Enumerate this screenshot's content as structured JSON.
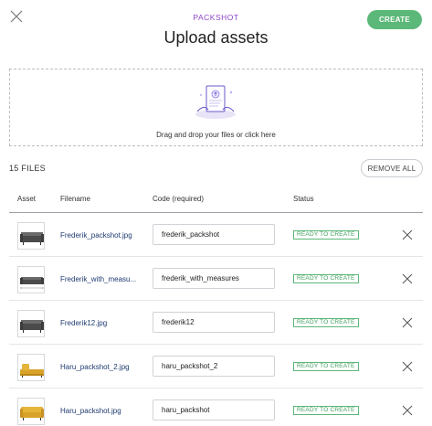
{
  "header": {
    "brand": "PACKSHOT",
    "title": "Upload assets",
    "create_label": "CREATE"
  },
  "dropzone": {
    "text": "Drag and drop your files or click here"
  },
  "files": {
    "count_label": "15 FILES",
    "remove_all_label": "REMOVE ALL"
  },
  "table": {
    "columns": [
      "Asset",
      "Filename",
      "Code (required)",
      "Status"
    ],
    "rows": [
      {
        "filename": "Frederik_packshot.jpg",
        "code": "frederik_packshot",
        "status": "READY TO CREATE",
        "thumb": "dark-sofa"
      },
      {
        "filename": "Frederik_with_measu...",
        "code": "frederik_with_measures",
        "status": "READY TO CREATE",
        "thumb": "dark-sofa-measures"
      },
      {
        "filename": "Frederik12.jpg",
        "code": "frederik12",
        "status": "READY TO CREATE",
        "thumb": "dark-sofa"
      },
      {
        "filename": "Haru_packshot_2.jpg",
        "code": "haru_packshot_2",
        "status": "READY TO CREATE",
        "thumb": "yellow-sofa-bed"
      },
      {
        "filename": "Haru_packshot.jpg",
        "code": "haru_packshot",
        "status": "READY TO CREATE",
        "thumb": "yellow-sofa"
      }
    ]
  },
  "colors": {
    "accent_green": "#5cb878",
    "brand_purple": "#8e44c8",
    "filename_blue": "#1f3a70"
  },
  "icons": {
    "close": "close-icon",
    "upload_illustration": "upload-illustration",
    "row_remove": "remove-row-icon"
  }
}
